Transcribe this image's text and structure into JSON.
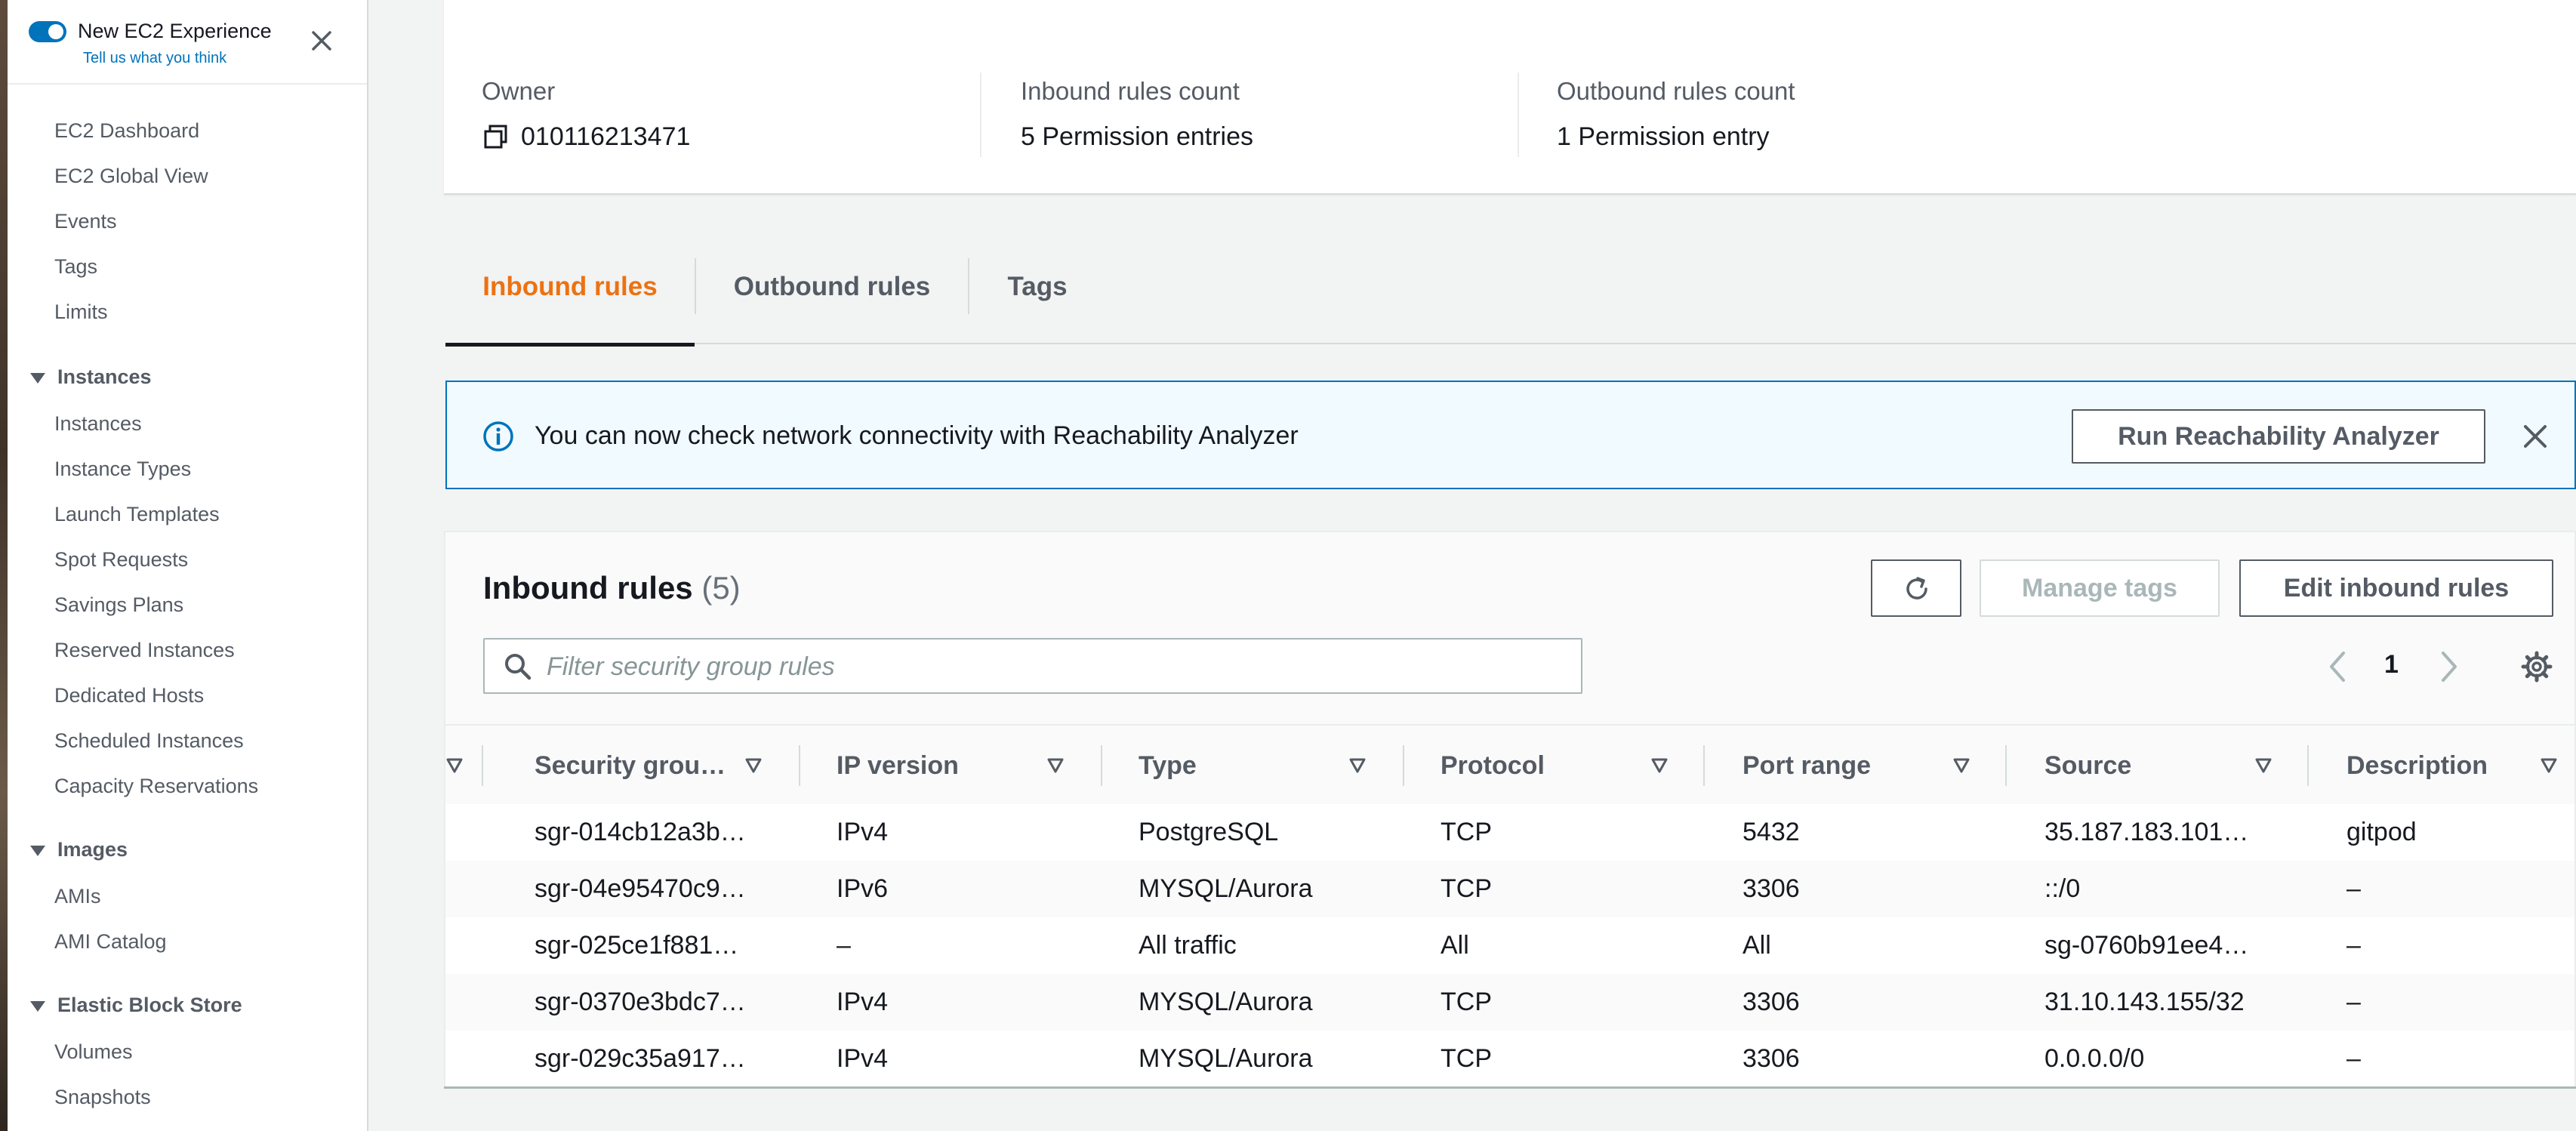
{
  "sidebar": {
    "title": "New EC2 Experience",
    "subtitle": "Tell us what you think",
    "items": {
      "dashboard": "EC2 Dashboard",
      "global_view": "EC2 Global View",
      "events": "Events",
      "tags": "Tags",
      "limits": "Limits",
      "sec_instances": "Instances",
      "instances": "Instances",
      "instance_types": "Instance Types",
      "launch_templates": "Launch Templates",
      "spot_requests": "Spot Requests",
      "savings_plans": "Savings Plans",
      "reserved_instances": "Reserved Instances",
      "dedicated_hosts": "Dedicated Hosts",
      "scheduled_instances": "Scheduled Instances",
      "capacity_reservations": "Capacity Reservations",
      "sec_images": "Images",
      "amis": "AMIs",
      "ami_catalog": "AMI Catalog",
      "sec_ebs": "Elastic Block Store",
      "volumes": "Volumes",
      "snapshots": "Snapshots"
    }
  },
  "details": {
    "owner_label": "Owner",
    "owner_value": "010116213471",
    "inbound_label": "Inbound rules count",
    "inbound_value": "5 Permission entries",
    "outbound_label": "Outbound rules count",
    "outbound_value": "1 Permission entry"
  },
  "tabs": {
    "inbound": "Inbound rules",
    "outbound": "Outbound rules",
    "tags": "Tags"
  },
  "banner": {
    "text": "You can now check network connectivity with Reachability Analyzer",
    "button": "Run Reachability Analyzer"
  },
  "rules": {
    "title": "Inbound rules",
    "count": "(5)",
    "manage_tags": "Manage tags",
    "edit": "Edit inbound rules",
    "search_placeholder": "Filter security group rules",
    "page": "1",
    "columns": {
      "sgr": "Security grou…",
      "ip": "IP version",
      "type": "Type",
      "protocol": "Protocol",
      "port": "Port range",
      "source": "Source",
      "desc": "Description"
    },
    "rows": [
      {
        "sgr": "sgr-014cb12a3b…",
        "ip": "IPv4",
        "type": "PostgreSQL",
        "protocol": "TCP",
        "port": "5432",
        "source": "35.187.183.101…",
        "desc": "gitpod"
      },
      {
        "sgr": "sgr-04e95470c9…",
        "ip": "IPv6",
        "type": "MYSQL/Aurora",
        "protocol": "TCP",
        "port": "3306",
        "source": "::/0",
        "desc": "–"
      },
      {
        "sgr": "sgr-025ce1f881…",
        "ip": "–",
        "type": "All traffic",
        "protocol": "All",
        "port": "All",
        "source": "sg-0760b91ee4…",
        "desc": "–"
      },
      {
        "sgr": "sgr-0370e3bdc7…",
        "ip": "IPv4",
        "type": "MYSQL/Aurora",
        "protocol": "TCP",
        "port": "3306",
        "source": "31.10.143.155/32",
        "desc": "–"
      },
      {
        "sgr": "sgr-029c35a917…",
        "ip": "IPv4",
        "type": "MYSQL/Aurora",
        "protocol": "TCP",
        "port": "3306",
        "source": "0.0.0.0/0",
        "desc": "–"
      }
    ]
  }
}
